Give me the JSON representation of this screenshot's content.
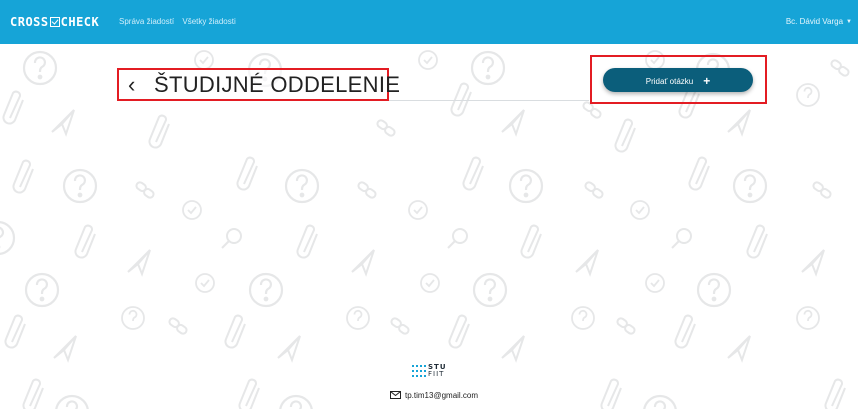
{
  "navbar": {
    "brand": {
      "left": "CROSS",
      "right": "CHECK"
    },
    "links": [
      "Správa žiadostí",
      "Všetky žiadosti"
    ],
    "user": "Bc. Dávid Varga",
    "color": "#16a4d7"
  },
  "main": {
    "title": "ŠTUDIJNÉ ODDELENIE",
    "back_icon": "chevron-left-icon",
    "add_button": "Pridať otázku",
    "add_icon": "plus-icon",
    "button_color": "#0b5e7b",
    "highlight_color": "#e31c23"
  },
  "footer": {
    "logo": {
      "top": "STU",
      "bottom": "FIIT"
    },
    "email": "tp.tim13@gmail.com",
    "email_icon": "envelope-icon"
  }
}
